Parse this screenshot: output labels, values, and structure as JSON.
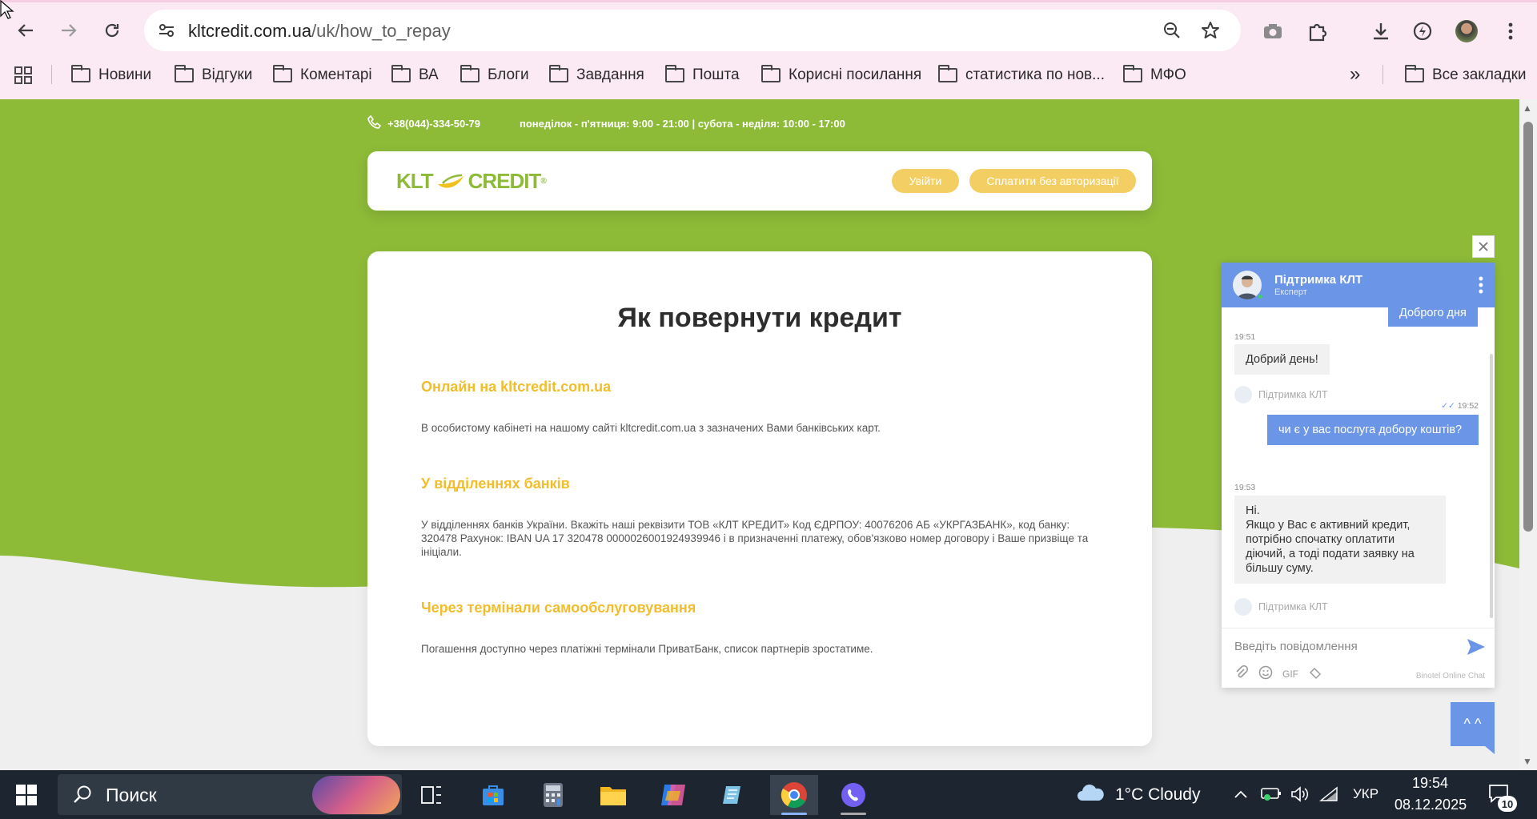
{
  "browser": {
    "url_host": "kltcredit.com.ua",
    "url_path": "/uk/how_to_repay",
    "bookmarks": [
      "Новини",
      "Відгуки",
      "Коментарі",
      "ВА",
      "Блоги",
      "Завдання",
      "Пошта",
      "Корисні посилання",
      "статистика по нов...",
      "МФО"
    ],
    "all_bookmarks": "Все закладки",
    "more_glyph": "»"
  },
  "site": {
    "phone": "+38(044)-334-50-79",
    "hours": "понеділок - п'ятниця: 9:00 - 21:00 | субота - неділя: 10:00 - 17:00",
    "logo_left": "KLT",
    "logo_right": "CREDIT",
    "login_button": "Увійти",
    "pay_button": "Сплатити без авторизації",
    "title": "Як повернути кредит",
    "sections": [
      {
        "heading": "Онлайн на kltcredit.com.ua",
        "text": "В особистому кабінеті на нашому сайті kltcredit.com.ua з зазначених Вами банківських карт."
      },
      {
        "heading": "У відділеннях банків",
        "text": "У відділеннях банків України. Вкажіть наші реквізити ТОВ «КЛТ КРЕДИТ» Код ЄДРПОУ: 40076206 АБ «УКРГАЗБАНК», код банку: 320478 Рахунок: IBAN UA 17 320478 0000026001924939946 і в призначенні платежу, обов'язково номер договору і Ваше призвіще та ініціали."
      },
      {
        "heading": "Через термінали самообслуговування",
        "text": "Погашення доступно через платіжні термінали ПриватБанк, список партнерів зростатиме."
      }
    ]
  },
  "chat": {
    "agent_name": "Підтримка КЛТ",
    "agent_role": "Експерт",
    "partial_top": "Доброго дня",
    "messages": [
      {
        "time": "19:51",
        "text": "Добрий день!",
        "from": "agent"
      },
      {
        "time": "19:52",
        "text": "чи є у вас послуга добору коштів?",
        "from": "user"
      },
      {
        "time": "19:53",
        "text": "Ні.\nЯкщо у Вас є активний кредит, потрібно спочатку оплатити діючий, а тоді подати заявку на більшу суму.",
        "from": "agent"
      }
    ],
    "agent_tag": "Підтримка КЛТ",
    "input_placeholder": "Введіть повідомлення",
    "gif_label": "GIF",
    "powered_by": "Binotel Online Chat",
    "toggle_glyph": "^ ^"
  },
  "taskbar": {
    "search_placeholder": "Поиск",
    "weather": "1°C  Cloudy",
    "language": "УКР",
    "time": "19:54",
    "date": "08.12.2025",
    "notifications": "10"
  },
  "colors": {
    "green": "#8dbb38",
    "accent_yellow": "#f2bd2b",
    "chat_blue": "#6b95e6",
    "browser_chrome": "#fbe9f3",
    "taskbar": "#1c2530"
  }
}
